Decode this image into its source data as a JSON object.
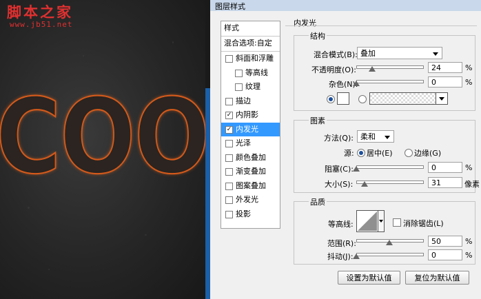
{
  "watermark": {
    "title": "脚本之家",
    "url": "www.jb51.net"
  },
  "artwork": {
    "text": "COO"
  },
  "dialog": {
    "title": "图层样式"
  },
  "style_list": {
    "header": "样式",
    "blending": "混合选项:自定",
    "items": [
      {
        "label": "斜面和浮雕",
        "checked": false,
        "indent": false
      },
      {
        "label": "等高线",
        "checked": false,
        "indent": true
      },
      {
        "label": "纹理",
        "checked": false,
        "indent": true
      },
      {
        "label": "描边",
        "checked": false,
        "indent": false
      },
      {
        "label": "内阴影",
        "checked": true,
        "indent": false
      },
      {
        "label": "内发光",
        "checked": true,
        "indent": false,
        "selected": true
      },
      {
        "label": "光泽",
        "checked": false,
        "indent": false
      },
      {
        "label": "颜色叠加",
        "checked": false,
        "indent": false
      },
      {
        "label": "渐变叠加",
        "checked": false,
        "indent": false
      },
      {
        "label": "图案叠加",
        "checked": false,
        "indent": false
      },
      {
        "label": "外发光",
        "checked": false,
        "indent": false
      },
      {
        "label": "投影",
        "checked": false,
        "indent": false
      }
    ]
  },
  "inner_glow": {
    "title": "内发光",
    "structure": {
      "title": "结构",
      "blend_mode_label": "混合模式(B):",
      "blend_mode_value": "叠加",
      "opacity_label": "不透明度(O):",
      "opacity_value": "24",
      "opacity_unit": "%",
      "opacity_fraction": 0.24,
      "noise_label": "杂色(N):",
      "noise_value": "0",
      "noise_unit": "%",
      "noise_fraction": 0,
      "glow_color": "#ffffff"
    },
    "elements": {
      "title": "图素",
      "technique_label": "方法(Q):",
      "technique_value": "柔和",
      "source_label": "源:",
      "source_center": "居中(E)",
      "source_edge": "边缘(G)",
      "choke_label": "阻塞(C):",
      "choke_value": "0",
      "choke_unit": "%",
      "choke_fraction": 0,
      "size_label": "大小(S):",
      "size_value": "31",
      "size_unit": "像素",
      "size_fraction": 0.125
    },
    "quality": {
      "title": "品质",
      "contour_label": "等高线:",
      "antialias_label": "消除锯齿(L)",
      "range_label": "范围(R):",
      "range_value": "50",
      "range_unit": "%",
      "range_fraction": 0.5,
      "jitter_label": "抖动(J):",
      "jitter_value": "0",
      "jitter_unit": "%",
      "jitter_fraction": 0
    },
    "buttons": {
      "make_default": "设置为默认值",
      "reset_default": "复位为默认值"
    }
  }
}
